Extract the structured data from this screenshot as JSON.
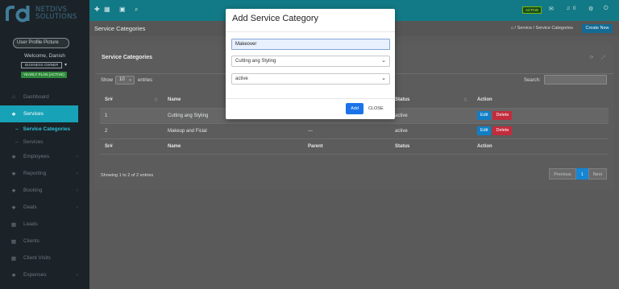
{
  "sidebar": {
    "brand_line1": "NETDIVS",
    "brand_line2": "SOLUTIONS",
    "user_image_alt": "User Profile Picture",
    "welcome": "Welcome, Danish",
    "role": "BUSINESS OWNER",
    "plan": "YEARLY PLAN (ACTIVE)",
    "items": [
      {
        "label": "Dashboard",
        "icon": "dashboard-icon"
      },
      {
        "label": "Services",
        "icon": "services-icon",
        "active": true
      },
      {
        "label": "Service Categories",
        "sub": true,
        "active": true
      },
      {
        "label": "Services",
        "sub": true
      },
      {
        "label": "Employees",
        "icon": "employees-icon"
      },
      {
        "label": "Reporting",
        "icon": "reporting-icon"
      },
      {
        "label": "Booking",
        "icon": "booking-icon"
      },
      {
        "label": "Deals",
        "icon": "deals-icon"
      },
      {
        "label": "Leads",
        "icon": "leads-icon"
      },
      {
        "label": "Clients",
        "icon": "clients-icon"
      },
      {
        "label": "Client Visits",
        "icon": "client-visits-icon"
      },
      {
        "label": "Expenses",
        "icon": "expenses-icon"
      }
    ]
  },
  "topbar": {
    "status_badge": "ACTIVE",
    "notif_count": "0"
  },
  "header": {
    "page_title": "Service Categories",
    "breadcrumb": "/ Service / Service Categories",
    "create_label": "Create New"
  },
  "card": {
    "title": "Service Categories",
    "show_label": "Show",
    "show_value": "10",
    "entries_label": "entries",
    "search_label": "Search:",
    "columns": [
      "Sr#",
      "Name",
      "Parent",
      "Status",
      "Action"
    ],
    "rows": [
      {
        "sr": "1",
        "name": "Cutting ang Styling",
        "parent": "",
        "status": "active"
      },
      {
        "sr": "2",
        "name": "Makeup and Ficial",
        "parent": "---",
        "status": "active"
      }
    ],
    "edit_label": "Edit",
    "delete_label": "Delete",
    "showing_text": "Showing 1 to 2 of 2 entries",
    "pager": {
      "prev": "Previous",
      "current": "1",
      "next": "Next"
    }
  },
  "modal": {
    "title": "Add Service Category",
    "name_value": "Makeover",
    "parent_value": "Cutting ang Styling",
    "status_value": "active",
    "add_label": "Add",
    "close_label": "CLOSE"
  },
  "colors": {
    "topbar": "#127a86",
    "sidebar": "#1b2328",
    "active_menu": "#17a2b8",
    "primary": "#1a73e8",
    "danger": "#c22c3c"
  }
}
